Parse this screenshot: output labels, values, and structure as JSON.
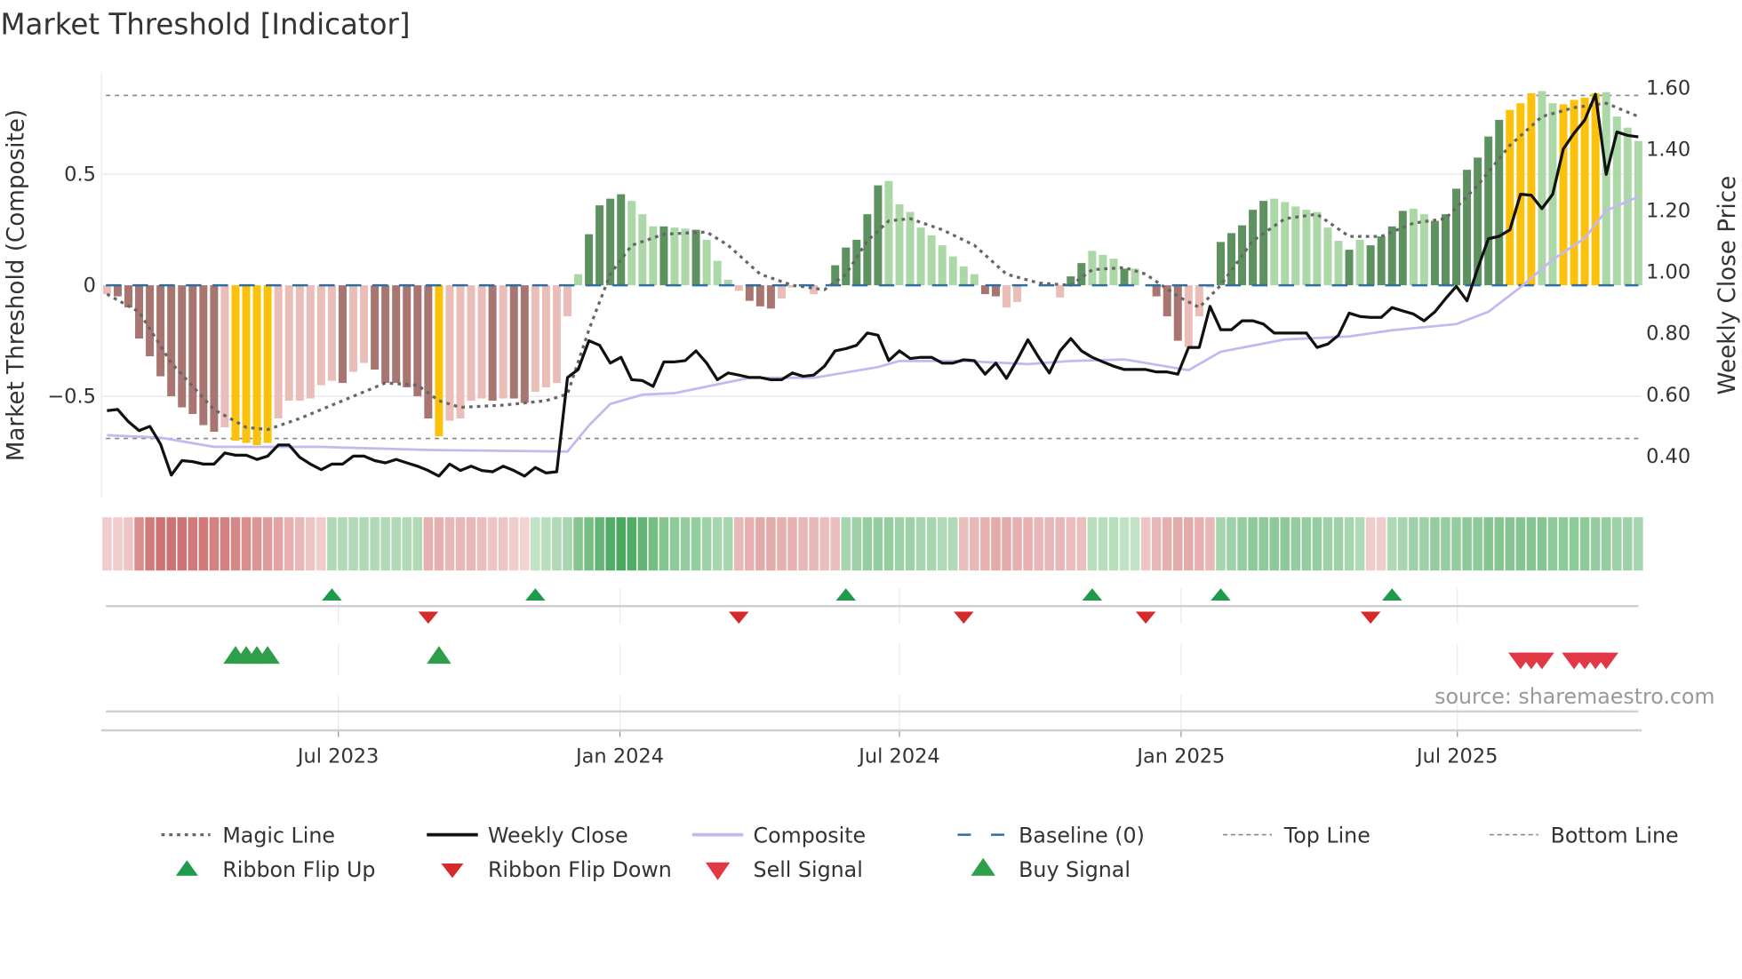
{
  "title": "Market Threshold [Indicator]",
  "source": "source: sharemaestro.com",
  "colors": {
    "dark_neg": "#a97570",
    "light_neg": "#ebbdb8",
    "signal": "#fcc10b",
    "dark_pos": "#5e9160",
    "light_pos": "#acd8a7",
    "magic": "#666666",
    "close": "#111111",
    "composite": "#c3b8f0",
    "baseline": "#2f6f9d",
    "threshold": "#888888",
    "flip_up": "#1f9a4a",
    "flip_down": "#d42a2a",
    "buy": "#2e9e4a",
    "sell": "#e03845"
  },
  "chart_data": {
    "type": "bar+line",
    "title": "Market Threshold [Indicator]",
    "ylabel_left": "Market Threshold (Composite)",
    "ylabel_right": "Weekly Close Price",
    "left_ticks": [
      {
        "value": 0.5,
        "label": "0.5"
      },
      {
        "value": 0,
        "label": "0"
      },
      {
        "value": -0.5,
        "label": "−0.5"
      }
    ],
    "right_ticks": [
      {
        "value": 1.6,
        "label": "1.60"
      },
      {
        "value": 1.4,
        "label": "1.40"
      },
      {
        "value": 1.2,
        "label": "1.20"
      },
      {
        "value": 1.0,
        "label": "1.00"
      },
      {
        "value": 0.8,
        "label": "0.80"
      },
      {
        "value": 0.6,
        "label": "0.60"
      },
      {
        "value": 0.4,
        "label": "0.40"
      }
    ],
    "x_ticks": [
      {
        "week": 21.6,
        "label": "Jul 2023"
      },
      {
        "week": 47.9,
        "label": "Jan 2024"
      },
      {
        "week": 74,
        "label": "Jul 2024"
      },
      {
        "week": 100.3,
        "label": "Jan 2025"
      },
      {
        "week": 126.1,
        "label": "Jul 2025"
      }
    ],
    "top_line": 0.855,
    "bottom_line": -0.69,
    "baseline": 0,
    "composite_bars": {
      "values": [
        -0.04,
        -0.05,
        -0.1,
        -0.24,
        -0.32,
        -0.41,
        -0.5,
        -0.55,
        -0.58,
        -0.63,
        -0.66,
        -0.64,
        -0.7,
        -0.71,
        -0.72,
        -0.71,
        -0.6,
        -0.52,
        -0.52,
        -0.51,
        -0.45,
        -0.43,
        -0.44,
        -0.39,
        -0.35,
        -0.38,
        -0.44,
        -0.44,
        -0.46,
        -0.5,
        -0.6,
        -0.68,
        -0.61,
        -0.6,
        -0.52,
        -0.51,
        -0.52,
        -0.51,
        -0.51,
        -0.53,
        -0.48,
        -0.46,
        -0.44,
        -0.14,
        0.05,
        0.23,
        0.36,
        0.39,
        0.41,
        0.38,
        0.32,
        0.265,
        0.265,
        0.26,
        0.255,
        0.25,
        0.205,
        0.11,
        0.025,
        -0.025,
        -0.07,
        -0.095,
        -0.105,
        -0.06,
        -0.01,
        0,
        -0.04,
        0,
        0.09,
        0.17,
        0.205,
        0.32,
        0.45,
        0.47,
        0.365,
        0.33,
        0.26,
        0.225,
        0.18,
        0.13,
        0.085,
        0.05,
        -0.04,
        -0.05,
        -0.1,
        -0.075,
        0,
        0,
        0,
        -0.055,
        0.04,
        0.1,
        0.155,
        0.137,
        0.12,
        0.075,
        0.075,
        0,
        -0.05,
        -0.14,
        -0.25,
        -0.28,
        -0.14,
        -0.01,
        0.195,
        0.235,
        0.27,
        0.34,
        0.38,
        0.39,
        0.375,
        0.355,
        0.34,
        0.33,
        0.26,
        0.2,
        0.16,
        0.205,
        0.18,
        0.22,
        0.265,
        0.335,
        0.345,
        0.32,
        0.29,
        0.32,
        0.435,
        0.52,
        0.575,
        0.67,
        0.745,
        0.79,
        0.82,
        0.865,
        0.875,
        0.82,
        0.815,
        0.835,
        0.845,
        0.865,
        0.87,
        0.76,
        0.71,
        0.65
      ],
      "styles": "LDDDDDDDDDDLYYYYLLLLLLDLLDDDDDDYLLLLDLDDLLLLLDDDDLLLDLLDLLLLDDDLLLLLDDDDDLLLLLLLLLDDLLLLDLDDLLLDLDDDDLLLDDDDDLLLLLLLDLDDDDLLDDDDDDDYYYLLYYYYLLL"
    },
    "weekly_close": [
      0.548,
      0.552,
      0.512,
      0.483,
      0.497,
      0.439,
      0.338,
      0.385,
      0.382,
      0.374,
      0.374,
      0.41,
      0.403,
      0.403,
      0.389,
      0.4,
      0.436,
      0.436,
      0.396,
      0.374,
      0.356,
      0.374,
      0.374,
      0.4,
      0.4,
      0.385,
      0.378,
      0.389,
      0.378,
      0.367,
      0.353,
      0.335,
      0.374,
      0.353,
      0.367,
      0.353,
      0.349,
      0.367,
      0.353,
      0.335,
      0.363,
      0.345,
      0.349,
      0.656,
      0.682,
      0.776,
      0.761,
      0.703,
      0.722,
      0.649,
      0.646,
      0.627,
      0.707,
      0.707,
      0.711,
      0.743,
      0.703,
      0.649,
      0.671,
      0.664,
      0.656,
      0.656,
      0.649,
      0.649,
      0.671,
      0.66,
      0.664,
      0.693,
      0.743,
      0.75,
      0.761,
      0.801,
      0.794,
      0.711,
      0.743,
      0.718,
      0.722,
      0.722,
      0.703,
      0.703,
      0.714,
      0.711,
      0.667,
      0.703,
      0.653,
      0.714,
      0.779,
      0.722,
      0.671,
      0.743,
      0.783,
      0.743,
      0.722,
      0.707,
      0.693,
      0.682,
      0.682,
      0.682,
      0.674,
      0.674,
      0.667,
      0.754,
      0.754,
      0.888,
      0.812,
      0.812,
      0.841,
      0.841,
      0.83,
      0.801,
      0.801,
      0.801,
      0.801,
      0.754,
      0.765,
      0.794,
      0.866,
      0.855,
      0.852,
      0.852,
      0.884,
      0.873,
      0.863,
      0.841,
      0.87,
      0.913,
      0.953,
      0.906,
      1.011,
      1.108,
      1.116,
      1.137,
      1.253,
      1.25,
      1.206,
      1.253,
      1.401,
      1.452,
      1.495,
      1.579,
      1.318,
      1.456,
      1.445,
      1.44
    ],
    "magic_line": [
      [
        0,
        -0.04
      ],
      [
        3,
        -0.12
      ],
      [
        6,
        -0.35
      ],
      [
        10,
        -0.56
      ],
      [
        13,
        -0.64
      ],
      [
        15,
        -0.65
      ],
      [
        18,
        -0.6
      ],
      [
        22,
        -0.52
      ],
      [
        26,
        -0.44
      ],
      [
        29,
        -0.45
      ],
      [
        31,
        -0.52
      ],
      [
        33,
        -0.55
      ],
      [
        37,
        -0.54
      ],
      [
        41,
        -0.52
      ],
      [
        43,
        -0.49
      ],
      [
        45,
        -0.2
      ],
      [
        47,
        0.05
      ],
      [
        49,
        0.18
      ],
      [
        52,
        0.23
      ],
      [
        56,
        0.24
      ],
      [
        58,
        0.18
      ],
      [
        61,
        0.05
      ],
      [
        64,
        0.0
      ],
      [
        67,
        -0.02
      ],
      [
        69,
        0.05
      ],
      [
        71,
        0.2
      ],
      [
        73,
        0.29
      ],
      [
        75,
        0.3
      ],
      [
        78,
        0.25
      ],
      [
        81,
        0.18
      ],
      [
        84,
        0.05
      ],
      [
        87,
        0.01
      ],
      [
        90,
        0.0
      ],
      [
        92,
        0.07
      ],
      [
        95,
        0.08
      ],
      [
        97,
        0.05
      ],
      [
        100,
        -0.05
      ],
      [
        102,
        -0.1
      ],
      [
        104,
        0.0
      ],
      [
        107,
        0.2
      ],
      [
        110,
        0.3
      ],
      [
        113,
        0.32
      ],
      [
        116,
        0.22
      ],
      [
        119,
        0.22
      ],
      [
        122,
        0.28
      ],
      [
        125,
        0.3
      ],
      [
        128,
        0.45
      ],
      [
        131,
        0.63
      ],
      [
        134,
        0.76
      ],
      [
        137,
        0.8
      ],
      [
        140,
        0.82
      ],
      [
        143,
        0.76
      ]
    ],
    "composite_line": [
      [
        0,
        0.468
      ],
      [
        5,
        0.46
      ],
      [
        10,
        0.43
      ],
      [
        20,
        0.43
      ],
      [
        30,
        0.42
      ],
      [
        43,
        0.415
      ],
      [
        45,
        0.5
      ],
      [
        47,
        0.57
      ],
      [
        50,
        0.6
      ],
      [
        53,
        0.605
      ],
      [
        60,
        0.655
      ],
      [
        66,
        0.655
      ],
      [
        72,
        0.69
      ],
      [
        74,
        0.71
      ],
      [
        80,
        0.71
      ],
      [
        86,
        0.7
      ],
      [
        90,
        0.71
      ],
      [
        95,
        0.715
      ],
      [
        101,
        0.68
      ],
      [
        104,
        0.74
      ],
      [
        110,
        0.78
      ],
      [
        116,
        0.79
      ],
      [
        120,
        0.81
      ],
      [
        126,
        0.83
      ],
      [
        129,
        0.87
      ],
      [
        132,
        0.95
      ],
      [
        135,
        1.04
      ],
      [
        138,
        1.11
      ],
      [
        140,
        1.2
      ],
      [
        143,
        1.245
      ]
    ],
    "ribbon": [
      -0.15,
      -0.15,
      -0.2,
      -0.6,
      -0.75,
      -0.8,
      -0.8,
      -0.8,
      -0.75,
      -0.75,
      -0.7,
      -0.7,
      -0.65,
      -0.6,
      -0.55,
      -0.5,
      -0.45,
      -0.35,
      -0.3,
      -0.2,
      -0.15,
      0.3,
      0.3,
      0.3,
      0.3,
      0.3,
      0.3,
      0.3,
      0.3,
      0.3,
      -0.35,
      -0.35,
      -0.3,
      -0.3,
      -0.3,
      -0.25,
      -0.2,
      -0.2,
      -0.15,
      -0.1,
      0.2,
      0.25,
      0.3,
      0.35,
      0.55,
      0.65,
      0.75,
      0.85,
      0.9,
      0.85,
      0.75,
      0.65,
      0.55,
      0.5,
      0.45,
      0.45,
      0.4,
      0.35,
      0.35,
      -0.3,
      -0.35,
      -0.4,
      -0.4,
      -0.35,
      -0.35,
      -0.3,
      -0.3,
      -0.25,
      -0.25,
      0.35,
      0.4,
      0.45,
      0.45,
      0.45,
      0.4,
      0.4,
      0.35,
      0.35,
      0.3,
      0.3,
      -0.25,
      -0.3,
      -0.35,
      -0.4,
      -0.4,
      -0.35,
      -0.35,
      -0.3,
      -0.3,
      -0.3,
      -0.25,
      -0.25,
      0.25,
      0.25,
      0.25,
      0.2,
      0.2,
      -0.2,
      -0.3,
      -0.35,
      -0.4,
      -0.4,
      -0.35,
      -0.3,
      0.35,
      0.4,
      0.45,
      0.5,
      0.5,
      0.5,
      0.5,
      0.45,
      0.45,
      0.45,
      0.4,
      0.4,
      0.35,
      0.3,
      -0.15,
      -0.15,
      0.3,
      0.35,
      0.4,
      0.4,
      0.45,
      0.45,
      0.45,
      0.5,
      0.5,
      0.55,
      0.55,
      0.55,
      0.55,
      0.55,
      0.55,
      0.5,
      0.5,
      0.5,
      0.5,
      0.45,
      0.45,
      0.4,
      0.4,
      0.35
    ],
    "ribbon_flip_up_weeks": [
      21,
      40,
      69,
      92,
      104,
      120
    ],
    "ribbon_flip_down_weeks": [
      30,
      59,
      80,
      97,
      118
    ],
    "buy_signal_weeks": [
      12,
      13,
      14,
      15,
      31
    ],
    "sell_signal_weeks": [
      132,
      133,
      134,
      137,
      138,
      139,
      140
    ],
    "legend": [
      {
        "key": "magic",
        "label": "Magic Line"
      },
      {
        "key": "close",
        "label": "Weekly Close"
      },
      {
        "key": "composite",
        "label": "Composite"
      },
      {
        "key": "baseline",
        "label": "Baseline (0)"
      },
      {
        "key": "top",
        "label": "Top Line"
      },
      {
        "key": "bottom",
        "label": "Bottom Line"
      },
      {
        "key": "flip_up",
        "label": "Ribbon Flip Up"
      },
      {
        "key": "flip_down",
        "label": "Ribbon Flip Down"
      },
      {
        "key": "sell",
        "label": "Sell Signal"
      },
      {
        "key": "buy",
        "label": "Buy Signal"
      }
    ]
  }
}
